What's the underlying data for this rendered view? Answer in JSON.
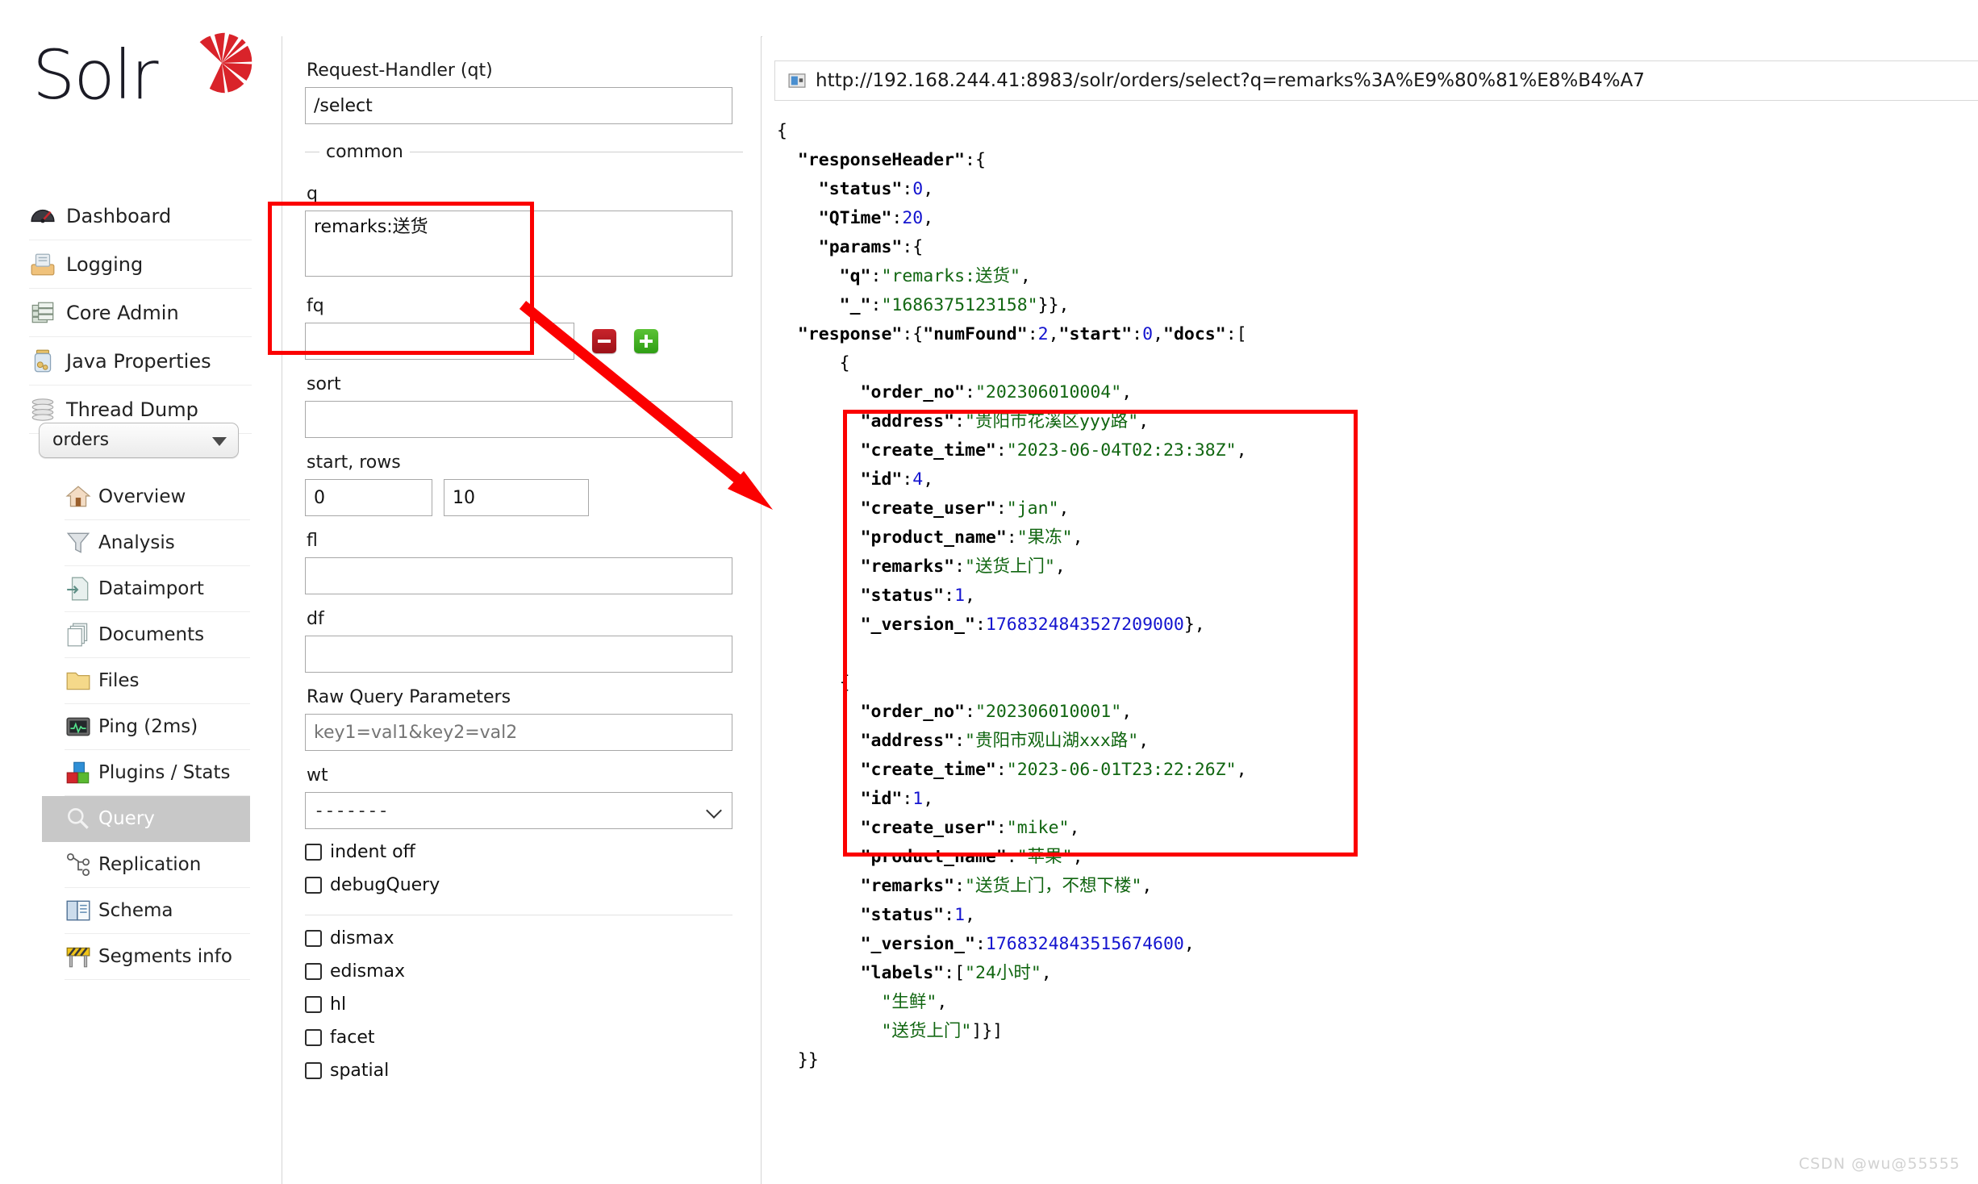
{
  "app": {
    "name": "Solr",
    "logo_icon": "solr-sunburst-logo"
  },
  "sidebar": {
    "top_items": [
      {
        "label": "Dashboard",
        "icon": "dashboard-gauge-icon"
      },
      {
        "label": "Logging",
        "icon": "logging-tray-icon"
      },
      {
        "label": "Core Admin",
        "icon": "core-admin-database-icon"
      },
      {
        "label": "Java Properties",
        "icon": "java-properties-jar-icon"
      },
      {
        "label": "Thread Dump",
        "icon": "thread-dump-stack-icon"
      }
    ],
    "core_selector": {
      "value": "orders",
      "caret_icon": "chevron-down-icon"
    },
    "core_items": [
      {
        "label": "Overview",
        "icon": "home-icon",
        "active": false
      },
      {
        "label": "Analysis",
        "icon": "funnel-icon",
        "active": false
      },
      {
        "label": "Dataimport",
        "icon": "dataimport-icon",
        "active": false
      },
      {
        "label": "Documents",
        "icon": "documents-icon",
        "active": false
      },
      {
        "label": "Files",
        "icon": "folder-icon",
        "active": false
      },
      {
        "label": "Ping (2ms)",
        "icon": "ping-monitor-icon",
        "active": false
      },
      {
        "label": "Plugins / Stats",
        "icon": "plugins-blocks-icon",
        "active": false
      },
      {
        "label": "Query",
        "icon": "magnifier-icon",
        "active": true
      },
      {
        "label": "Replication",
        "icon": "replication-nodes-icon",
        "active": false
      },
      {
        "label": "Schema",
        "icon": "schema-book-icon",
        "active": false
      },
      {
        "label": "Segments info",
        "icon": "segments-barrier-icon",
        "active": false
      }
    ]
  },
  "query_form": {
    "request_handler_label": "Request-Handler (qt)",
    "request_handler_value": "/select",
    "common_legend": "common",
    "q_label": "q",
    "q_value": "remarks:送货",
    "fq_label": "fq",
    "fq_value": "",
    "fq_remove_label": "−",
    "fq_add_label": "+",
    "sort_label": "sort",
    "sort_value": "",
    "start_rows_label": "start, rows",
    "start_value": "0",
    "rows_value": "10",
    "fl_label": "fl",
    "fl_value": "",
    "df_label": "df",
    "df_value": "",
    "raw_query_label": "Raw Query Parameters",
    "raw_query_placeholder": "key1=val1&key2=val2",
    "wt_label": "wt",
    "wt_value": "-------",
    "checkboxes_primary": [
      {
        "label": "indent off",
        "checked": false
      },
      {
        "label": "debugQuery",
        "checked": false
      }
    ],
    "checkboxes_secondary": [
      {
        "label": "dismax",
        "checked": false
      },
      {
        "label": "edismax",
        "checked": false
      },
      {
        "label": "hl",
        "checked": false
      },
      {
        "label": "facet",
        "checked": false
      },
      {
        "label": "spatial",
        "checked": false
      }
    ]
  },
  "result": {
    "url_icon": "external-link-icon",
    "url": "http://192.168.244.41:8983/solr/orders/select?q=remarks%3A%E9%80%81%E8%B4%A7",
    "response": {
      "responseHeader": {
        "status": 0,
        "QTime": 20,
        "params": {
          "q": "remarks:送货",
          "_": "1686375123158"
        }
      },
      "numFound": 2,
      "start": 0,
      "docs": [
        {
          "order_no": "202306010004",
          "address": "贵阳市花溪区yyy路",
          "create_time": "2023-06-04T02:23:38Z",
          "id": 4,
          "create_user": "jan",
          "product_name": "果冻",
          "remarks": "送货上门",
          "status": 1,
          "_version_": 1768324843527208960
        },
        {
          "order_no": "202306010001",
          "address": "贵阳市观山湖xxx路",
          "create_time": "2023-06-01T23:22:26Z",
          "id": 1,
          "create_user": "mike",
          "product_name": "苹果",
          "remarks": "送货上门，不想下楼",
          "status": 1,
          "_version_": 1768324843515674624,
          "labels": [
            "24小时",
            "生鲜",
            "送货上门"
          ]
        }
      ]
    }
  },
  "annotations": {
    "highlight_color": "#fb0000",
    "q_box": "highlights the q query field",
    "result_box": "highlights the returned docs",
    "arrow": "arrow from q field to results"
  },
  "watermark": "CSDN @wu@55555"
}
